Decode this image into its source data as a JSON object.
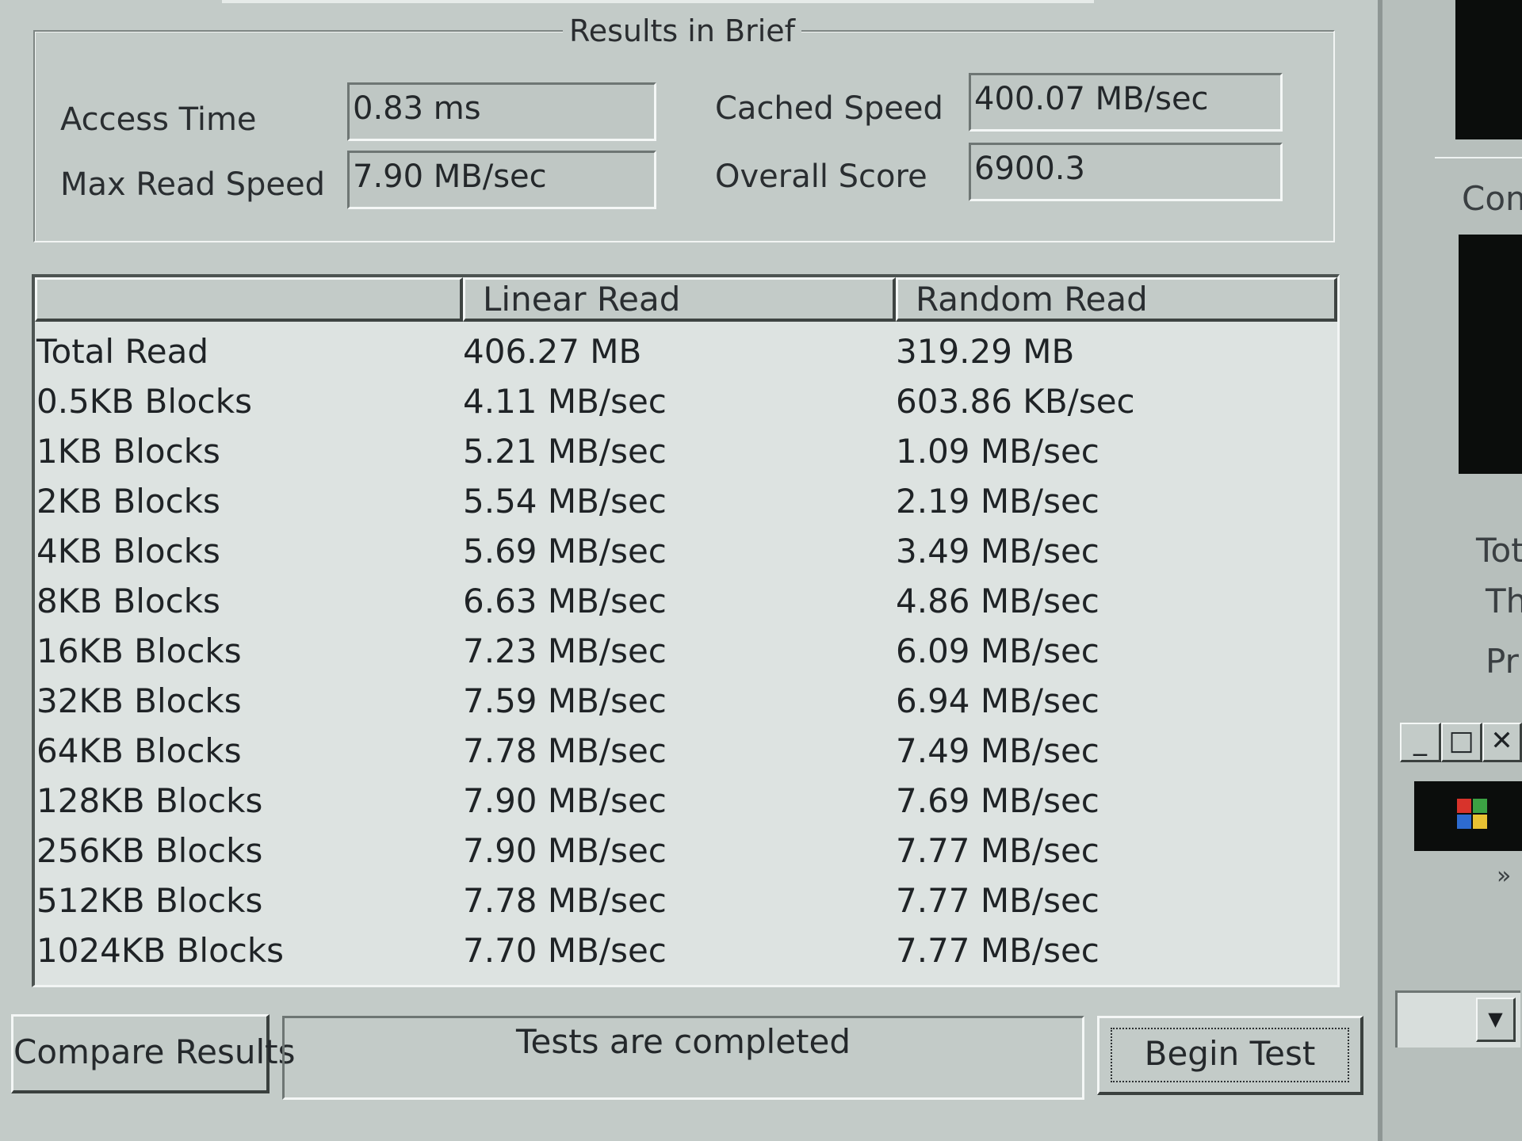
{
  "results_group": {
    "title": "Results in Brief",
    "access_time_label": "Access Time",
    "access_time_value": "0.83 ms",
    "max_read_label": "Max Read Speed",
    "max_read_value": "7.90 MB/sec",
    "cached_speed_label": "Cached Speed",
    "cached_speed_value": "400.07 MB/sec",
    "overall_score_label": "Overall Score",
    "overall_score_value": "6900.3"
  },
  "table": {
    "columns": [
      "",
      "Linear Read",
      "Random Read"
    ],
    "rows": [
      {
        "label": "Total Read",
        "linear": "406.27 MB",
        "random": "319.29 MB"
      },
      {
        "label": "0.5KB Blocks",
        "linear": "4.11 MB/sec",
        "random": "603.86 KB/sec"
      },
      {
        "label": "1KB Blocks",
        "linear": "5.21 MB/sec",
        "random": "1.09 MB/sec"
      },
      {
        "label": "2KB Blocks",
        "linear": "5.54 MB/sec",
        "random": "2.19 MB/sec"
      },
      {
        "label": "4KB Blocks",
        "linear": "5.69 MB/sec",
        "random": "3.49 MB/sec"
      },
      {
        "label": "8KB Blocks",
        "linear": "6.63 MB/sec",
        "random": "4.86 MB/sec"
      },
      {
        "label": "16KB Blocks",
        "linear": "7.23 MB/sec",
        "random": "6.09 MB/sec"
      },
      {
        "label": "32KB Blocks",
        "linear": "7.59 MB/sec",
        "random": "6.94 MB/sec"
      },
      {
        "label": "64KB Blocks",
        "linear": "7.78 MB/sec",
        "random": "7.49 MB/sec"
      },
      {
        "label": "128KB Blocks",
        "linear": "7.90 MB/sec",
        "random": "7.69 MB/sec"
      },
      {
        "label": "256KB Blocks",
        "linear": "7.90 MB/sec",
        "random": "7.77 MB/sec"
      },
      {
        "label": "512KB Blocks",
        "linear": "7.78 MB/sec",
        "random": "7.77 MB/sec"
      },
      {
        "label": "1024KB Blocks",
        "linear": "7.70 MB/sec",
        "random": "7.77 MB/sec"
      }
    ]
  },
  "bottom": {
    "compare_button": "Compare Results",
    "status_text": "Tests are completed",
    "begin_button": "Begin Test"
  },
  "right_panel": {
    "group1_fragment": "Com",
    "group2_fragment": "Tot",
    "label_th": "Th",
    "label_pr": "Pr",
    "chevron": "»"
  },
  "colors": {
    "window_face": "#c3cbc8",
    "list_background": "#dde3e1",
    "text": "#1f2326"
  }
}
